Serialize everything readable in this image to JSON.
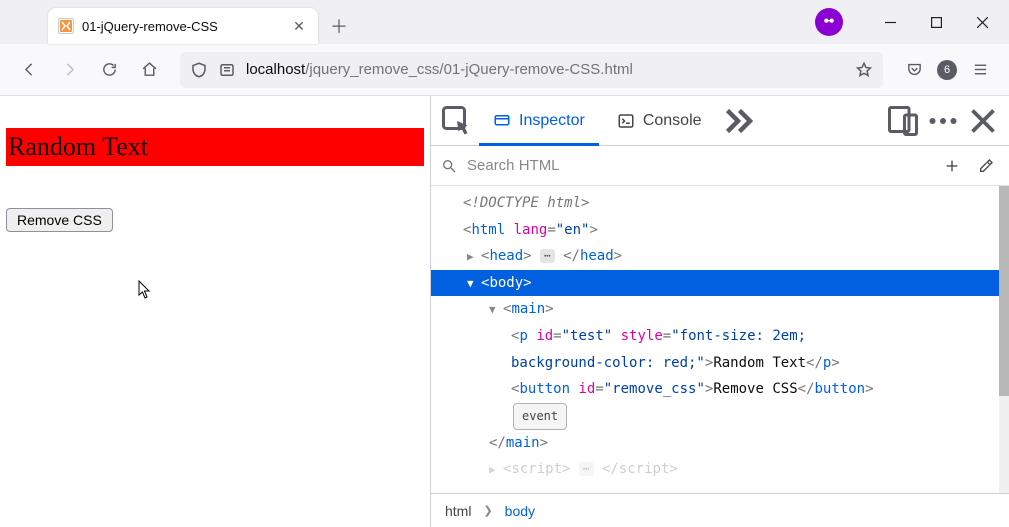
{
  "window": {
    "tab_title": "01-jQuery-remove-CSS",
    "minimize_label": "Minimize",
    "maximize_label": "Maximize",
    "close_label": "Close"
  },
  "toolbar": {
    "url_host": "localhost",
    "url_path": "/jquery_remove_css/01-jQuery-remove-CSS.html",
    "badge_count": "6"
  },
  "page": {
    "random_text": "Random Text",
    "button_label": "Remove CSS"
  },
  "devtools": {
    "tabs": {
      "inspector": "Inspector",
      "console": "Console"
    },
    "search_placeholder": "Search HTML",
    "event_badge": "event",
    "breadcrumb": [
      "html",
      "body"
    ],
    "tree": {
      "doctype": "<!DOCTYPE html>",
      "html_open": {
        "tag": "html",
        "attr": "lang",
        "val": "\"en\""
      },
      "head": "head",
      "body": "body",
      "main": "main",
      "p": {
        "tag": "p",
        "id_attr": "id",
        "id_val": "\"test\"",
        "style_attr": "style",
        "style_val1": "\"font-size: 2em;",
        "style_val2": "background-color: red;\"",
        "text": "Random Text"
      },
      "button": {
        "tag": "button",
        "id_attr": "id",
        "id_val": "\"remove_css\"",
        "text": "Remove CSS"
      },
      "script_frag_open": "<script>",
      "script_frag_close": "</script>"
    }
  }
}
